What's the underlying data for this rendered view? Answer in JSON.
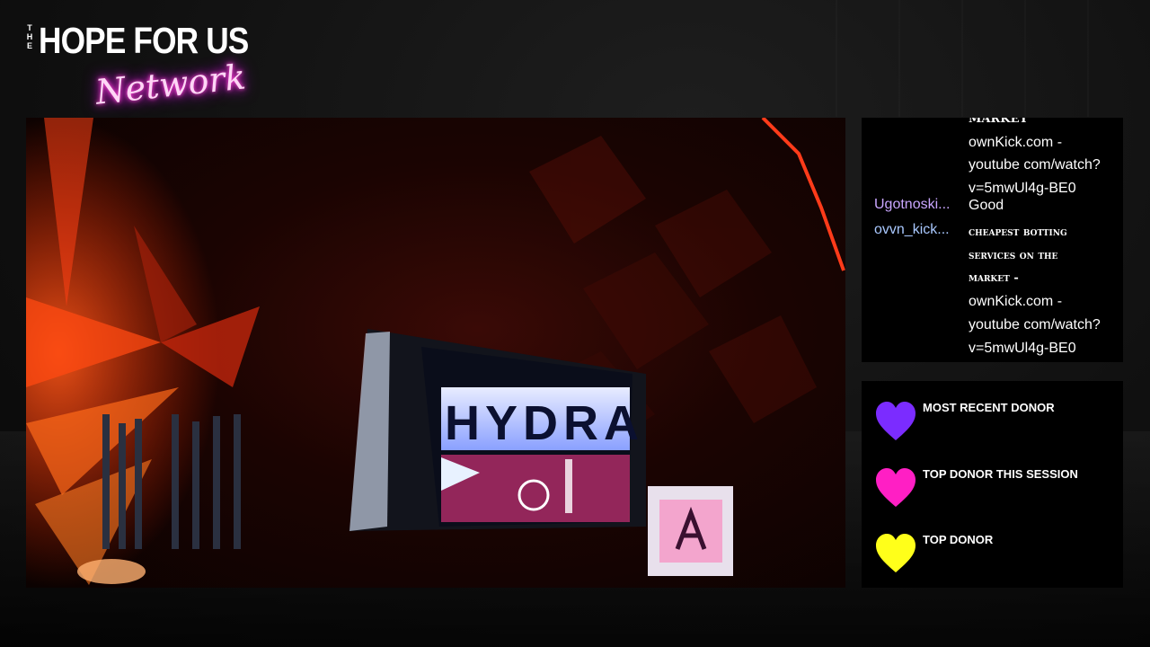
{
  "branding": {
    "the": "THE",
    "title": "HOPE FOR US",
    "script": "Network"
  },
  "video": {
    "screen_text": "HYDRA"
  },
  "chat": {
    "messages": [
      {
        "user": "",
        "lines": [
          "MARKET",
          "ownKick.com -",
          "youtube com/watch?",
          "v=5mwUl4g-BE0"
        ]
      },
      {
        "user": "Ugotnoski...",
        "user_color": "#c9a6ff",
        "lines": [
          "Good"
        ]
      },
      {
        "user": "ovvn_kick...",
        "user_color": "#a9c8ff",
        "lines": [
          "cheapest botting",
          "services on the",
          "market -",
          "ownKick.com -",
          "youtube com/watch?",
          "v=5mwUl4g-BE0"
        ]
      }
    ]
  },
  "donors": {
    "items": [
      {
        "label": "MOST RECENT DONOR",
        "color": "#7b2cff"
      },
      {
        "label": "TOP DONOR THIS SESSION",
        "color": "#ff1fc4"
      },
      {
        "label": "TOP DONOR",
        "color": "#ffff1a"
      }
    ]
  },
  "colors": {
    "accent_neon_pink": "#ff2bd0",
    "panel_background": "#000000"
  }
}
